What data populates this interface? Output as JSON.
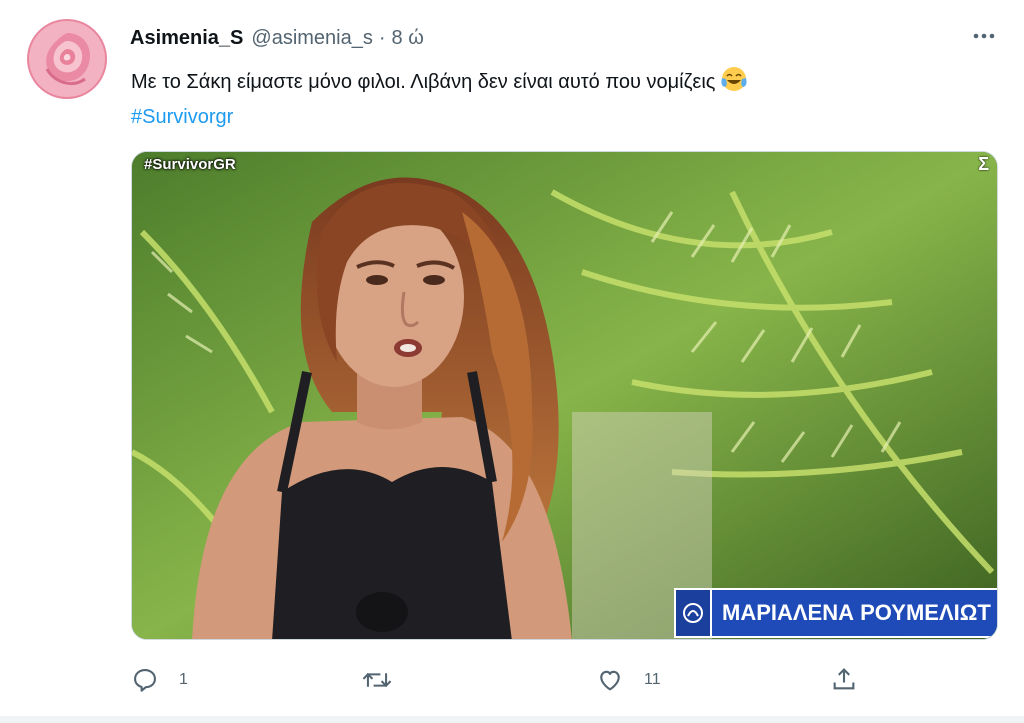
{
  "tweet": {
    "author_name": "Asimenia_S",
    "handle": "@asimenia_s",
    "separator": "·",
    "time": "8 ώ",
    "text_line1": "Με το Σάκη είμαστε μόνο φιλοι. Λιβάνη δεν είναι αυτό που νομίζεις",
    "emoji": "face-with-tears-of-joy",
    "hashtag": "#Survivorgr"
  },
  "media": {
    "overlay_tag": "#SurvivorGR",
    "overlay_corner": "Σ",
    "lower_third_name": "ΜΑΡΙΑΛΕΝΑ ΡΟΥΜΕΛΙΩΤ"
  },
  "actions": {
    "reply_count": "1",
    "retweet_count": "",
    "like_count": "11"
  },
  "colors": {
    "accent": "#1d9bf0",
    "secondary_text": "#536471",
    "lower_third_blue": "#1f4bb8"
  }
}
